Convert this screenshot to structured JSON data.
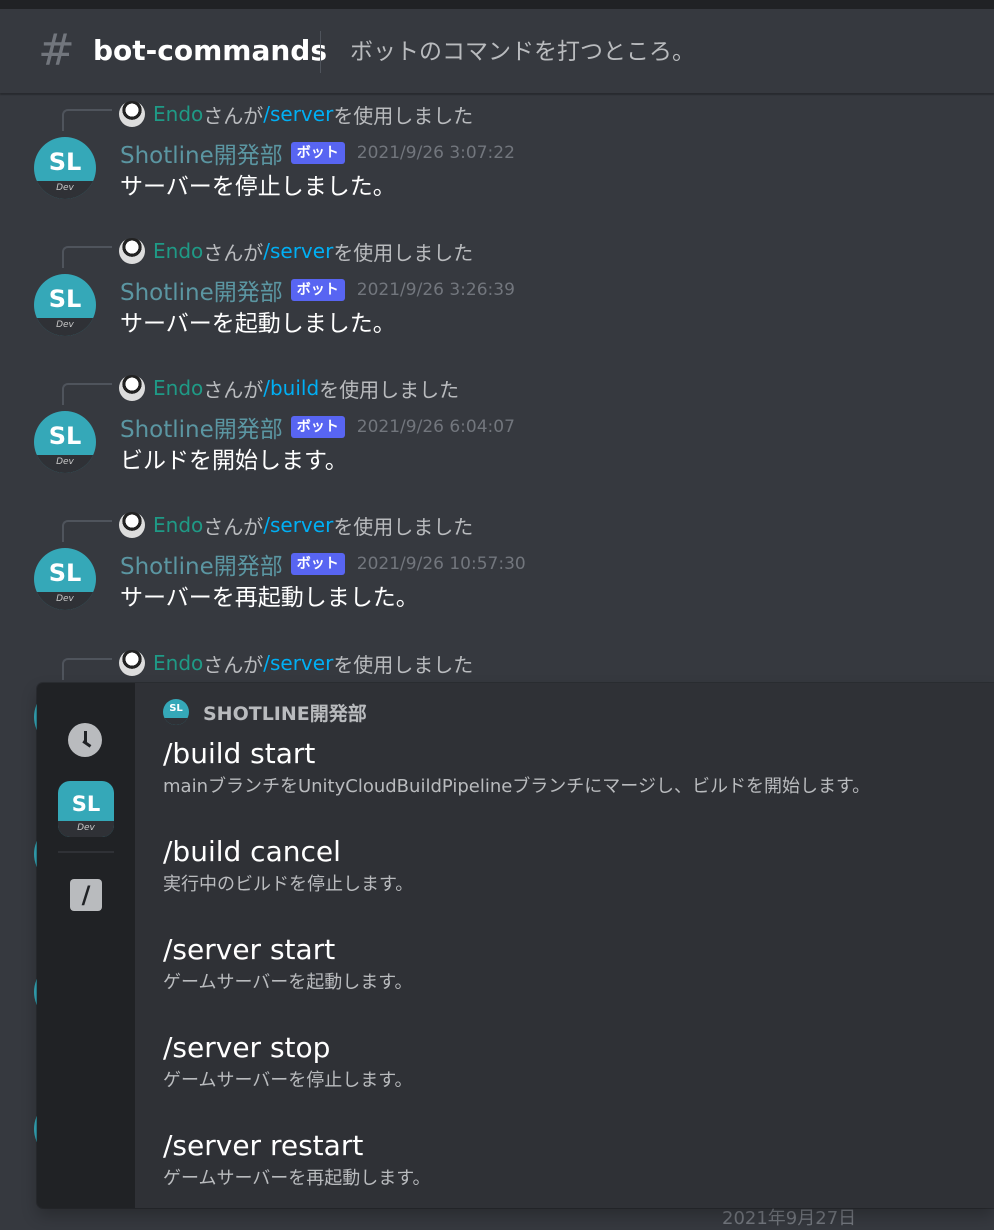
{
  "channel": {
    "name": "bot-commands",
    "topic": "ボットのコマンドを打つところ。"
  },
  "bot": {
    "avatar_initials": "SL",
    "avatar_sub": "Dev",
    "badge": "ボット"
  },
  "messages": [
    {
      "reply_user": "Endo",
      "reply_prefix": "さんが",
      "reply_cmd": "/server",
      "reply_suffix": "を使用しました",
      "username": "Shotline開発部",
      "timestamp": "2021/9/26 3:07:22",
      "content": "サーバーを停止しました。"
    },
    {
      "reply_user": "Endo",
      "reply_prefix": "さんが",
      "reply_cmd": "/server",
      "reply_suffix": "を使用しました",
      "username": "Shotline開発部",
      "timestamp": "2021/9/26 3:26:39",
      "content": "サーバーを起動しました。"
    },
    {
      "reply_user": "Endo",
      "reply_prefix": "さんが",
      "reply_cmd": "/build",
      "reply_suffix": "を使用しました",
      "username": "Shotline開発部",
      "timestamp": "2021/9/26 6:04:07",
      "content": "ビルドを開始します。"
    },
    {
      "reply_user": "Endo",
      "reply_prefix": "さんが",
      "reply_cmd": "/server",
      "reply_suffix": "を使用しました",
      "username": "Shotline開発部",
      "timestamp": "2021/9/26 10:57:30",
      "content": "サーバーを再起動しました。"
    }
  ],
  "partial_reply": {
    "reply_user": "Endo",
    "reply_prefix": "さんが",
    "reply_cmd": "/server",
    "reply_suffix": "を使用しました"
  },
  "popup": {
    "section_title": "SHOTLINE開発部",
    "commands": [
      {
        "name": "/build start",
        "description": "mainブランチをUnityCloudBuildPipelineブランチにマージし、ビルドを開始します。"
      },
      {
        "name": "/build cancel",
        "description": "実行中のビルドを停止します。"
      },
      {
        "name": "/server start",
        "description": "ゲームサーバーを起動します。"
      },
      {
        "name": "/server stop",
        "description": "ゲームサーバーを停止します。"
      },
      {
        "name": "/server restart",
        "description": "ゲームサーバーを再起動します。"
      }
    ]
  },
  "footer_date": "2021年9月27日",
  "colors": {
    "background": "#36393f",
    "popup": "#2f3136",
    "rail": "#202225",
    "bot_badge": "#5865f2",
    "avatar": "#35a8b8",
    "reply_user": "#1f9a86",
    "command_link": "#00aff4"
  }
}
